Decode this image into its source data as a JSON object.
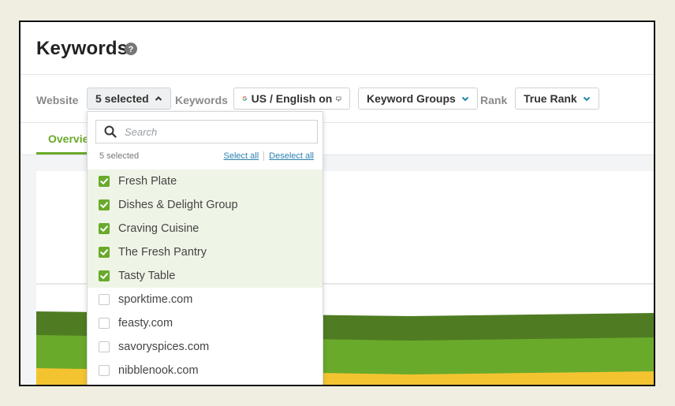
{
  "header": {
    "title": "Keywords",
    "help_icon": "question-circle-icon"
  },
  "filters": {
    "website_label": "Website",
    "website_value": "5 selected",
    "keywords_label": "Keywords",
    "keywords_value": "US / English on",
    "keyword_groups_label": "Keyword Groups",
    "rank_label": "Rank",
    "rank_value": "True Rank"
  },
  "tabs": {
    "overview": "Overview"
  },
  "dropdown": {
    "search_placeholder": "Search",
    "selected_count": "5 selected",
    "select_all": "Select all",
    "deselect_all": "Deselect all",
    "items": [
      {
        "label": "Fresh Plate",
        "checked": true
      },
      {
        "label": "Dishes & Delight Group",
        "checked": true
      },
      {
        "label": "Craving Cuisine",
        "checked": true
      },
      {
        "label": "The Fresh Pantry",
        "checked": true
      },
      {
        "label": "Tasty Table",
        "checked": true
      },
      {
        "label": "sporktime.com",
        "checked": false
      },
      {
        "label": "feasty.com",
        "checked": false
      },
      {
        "label": "savoryspices.com",
        "checked": false
      },
      {
        "label": "nibblenook.com",
        "checked": false
      }
    ]
  },
  "colors": {
    "accent_green": "#6aaa2b",
    "dark_green": "#4f7c22",
    "yellow": "#f4c430",
    "link_blue": "#2a7fb0"
  }
}
